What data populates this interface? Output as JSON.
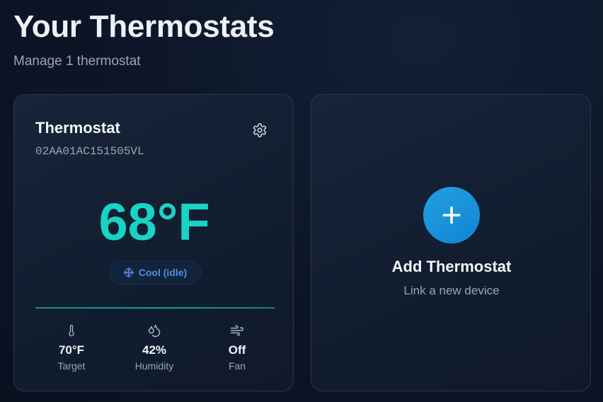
{
  "header": {
    "title": "Your Thermostats",
    "subtitle": "Manage 1 thermostat"
  },
  "thermostats": [
    {
      "name": "Thermostat",
      "serial": "02AA01AC151505VL",
      "current_temp": "68°F",
      "mode_label": "Cool (idle)",
      "mode_icon": "snowflake-icon",
      "stats": {
        "target": {
          "value": "70°F",
          "label": "Target",
          "icon": "thermometer-icon"
        },
        "humidity": {
          "value": "42%",
          "label": "Humidity",
          "icon": "droplets-icon"
        },
        "fan": {
          "value": "Off",
          "label": "Fan",
          "icon": "wind-icon"
        }
      }
    }
  ],
  "add_card": {
    "title": "Add Thermostat",
    "subtitle": "Link a new device",
    "icon": "plus-icon"
  },
  "colors": {
    "background": "#0b1322",
    "card_bg": "#152135",
    "temperature": "#19d3c4",
    "mode_text": "#4f8fe0",
    "divider": "#1ba19c",
    "add_button": "#1a93dc",
    "muted_text": "#9aa5b4"
  }
}
